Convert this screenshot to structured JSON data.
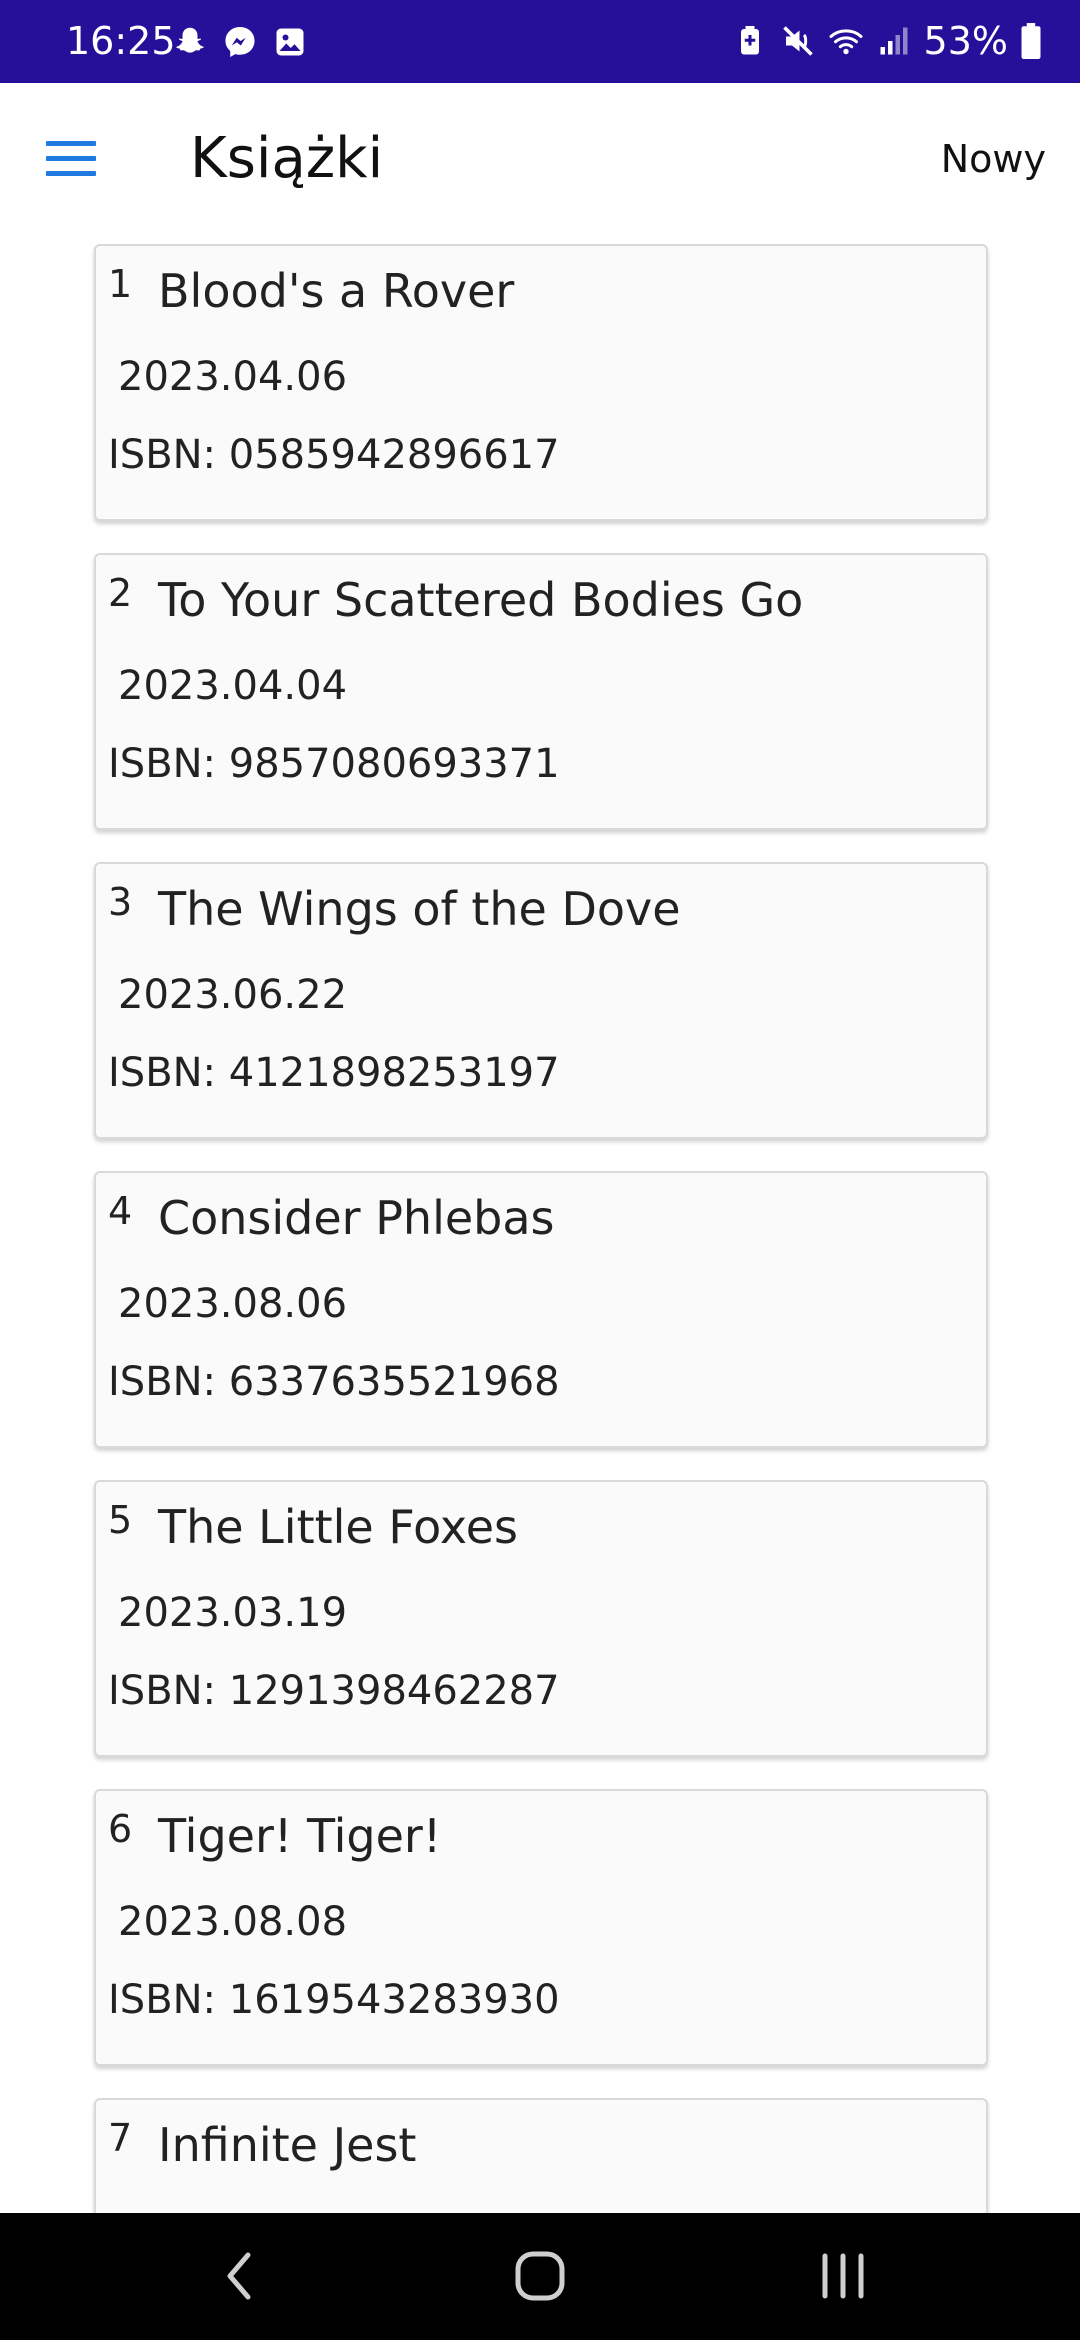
{
  "status_bar": {
    "time": "16:25",
    "battery_percent": "53%",
    "left_icons": [
      "snapchat-icon",
      "messenger-icon",
      "gallery-icon"
    ],
    "right_icons": [
      "battery-saver-icon",
      "mute-icon",
      "wifi-icon",
      "signal-icon",
      "battery-icon"
    ]
  },
  "app_bar": {
    "title": "Książki",
    "new_label": "Nowy"
  },
  "books": [
    {
      "num": "1",
      "title": "Blood's a Rover",
      "date": "2023.04.06",
      "isbn": "ISBN: 0585942896617"
    },
    {
      "num": "2",
      "title": "To Your Scattered Bodies Go",
      "date": "2023.04.04",
      "isbn": "ISBN: 9857080693371"
    },
    {
      "num": "3",
      "title": "The Wings of the Dove",
      "date": "2023.06.22",
      "isbn": "ISBN: 4121898253197"
    },
    {
      "num": "4",
      "title": "Consider Phlebas",
      "date": "2023.08.06",
      "isbn": "ISBN: 6337635521968"
    },
    {
      "num": "5",
      "title": "The Little Foxes",
      "date": "2023.03.19",
      "isbn": "ISBN: 1291398462287"
    },
    {
      "num": "6",
      "title": "Tiger! Tiger!",
      "date": "2023.08.08",
      "isbn": "ISBN: 1619543283930"
    },
    {
      "num": "7",
      "title": "Infinite Jest",
      "date": "",
      "isbn": ""
    }
  ],
  "colors": {
    "status_bar": "#260f99",
    "accent": "#1e7ae0",
    "card_bg": "#fafafa",
    "nav_bar": "#000000"
  },
  "nav_icons": [
    "back-icon",
    "home-icon",
    "recents-icon"
  ]
}
